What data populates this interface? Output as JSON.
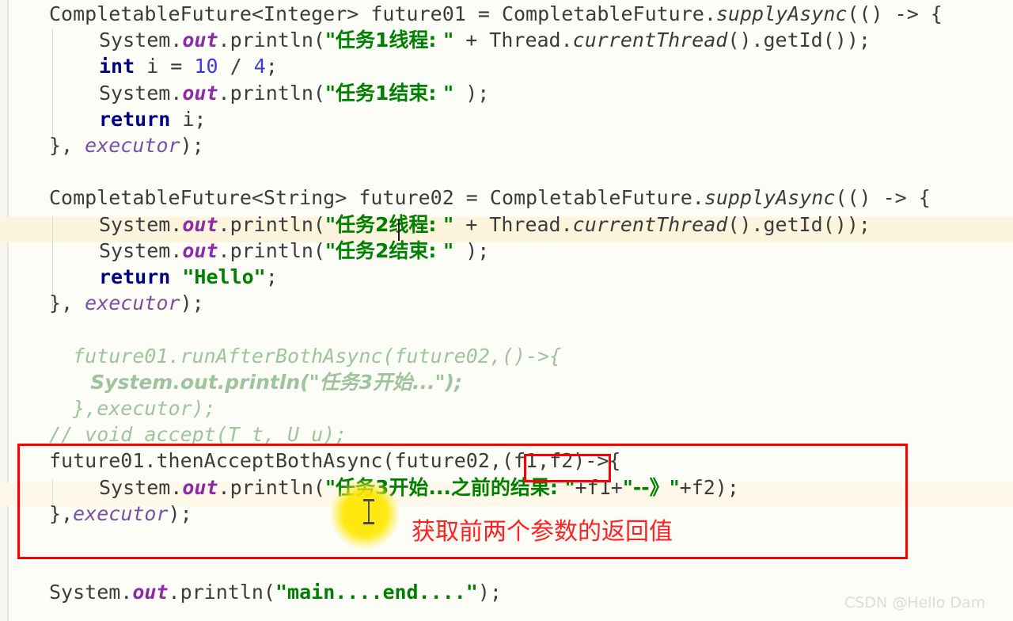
{
  "editor": {
    "language": "java",
    "watermark": "CSDN @Hello Dam",
    "colors": {
      "background": "#fdfdf7",
      "keyword": "#000080",
      "string": "#008000",
      "number": "#3a3ae0",
      "static_field": "#8c2ba8",
      "parameter": "#7a4fa3",
      "commented_code": "#9ec49e",
      "plain_text": "#3c3c3c",
      "annotation_red": "#ff0000",
      "click_highlight_yellow": "#ffe700",
      "current_line_highlight": "#fcf4dc"
    },
    "lines": [
      {
        "indent": 0,
        "tokens": [
          {
            "t": "CompletableFuture<Integer> future01 = CompletableFuture.",
            "c": "cm"
          },
          {
            "t": "supplyAsync",
            "c": "mth"
          },
          {
            "t": "(() -> {",
            "c": "cm"
          }
        ]
      },
      {
        "indent": 1,
        "tokens": [
          {
            "t": "System.",
            "c": "cm"
          },
          {
            "t": "out",
            "c": "fld"
          },
          {
            "t": ".println(",
            "c": "cm"
          },
          {
            "t": "\"任务1线程: \"",
            "c": "str"
          },
          {
            "t": " + Thread.",
            "c": "cm"
          },
          {
            "t": "currentThread",
            "c": "mth"
          },
          {
            "t": "().getId());",
            "c": "cm"
          }
        ]
      },
      {
        "indent": 1,
        "tokens": [
          {
            "t": "int",
            "c": "kw"
          },
          {
            "t": " i = ",
            "c": "cm"
          },
          {
            "t": "10",
            "c": "num"
          },
          {
            "t": " / ",
            "c": "cm"
          },
          {
            "t": "4",
            "c": "num"
          },
          {
            "t": ";",
            "c": "cm"
          }
        ]
      },
      {
        "indent": 1,
        "tokens": [
          {
            "t": "System.",
            "c": "cm"
          },
          {
            "t": "out",
            "c": "fld"
          },
          {
            "t": ".println(",
            "c": "cm"
          },
          {
            "t": "\"任务1结束: \"",
            "c": "str"
          },
          {
            "t": " );",
            "c": "cm"
          }
        ]
      },
      {
        "indent": 1,
        "tokens": [
          {
            "t": "return",
            "c": "kw"
          },
          {
            "t": " i;",
            "c": "cm"
          }
        ]
      },
      {
        "indent": 0,
        "tokens": [
          {
            "t": "}, ",
            "c": "cm"
          },
          {
            "t": "executor",
            "c": "par"
          },
          {
            "t": ");",
            "c": "cm"
          }
        ]
      },
      {
        "indent": 0,
        "tokens": []
      },
      {
        "indent": 0,
        "tokens": [
          {
            "t": "CompletableFuture<String> future02 = CompletableFuture.",
            "c": "cm"
          },
          {
            "t": "supplyAsync",
            "c": "mth"
          },
          {
            "t": "(() -> {",
            "c": "cm"
          }
        ]
      },
      {
        "indent": 1,
        "tokens": [
          {
            "t": "System.",
            "c": "cm"
          },
          {
            "t": "out",
            "c": "fld"
          },
          {
            "t": ".println(",
            "c": "cm"
          },
          {
            "t": "\"任务2线程: \"",
            "c": "str"
          },
          {
            "t": " + Thread.",
            "c": "cm"
          },
          {
            "t": "currentThread",
            "c": "mth"
          },
          {
            "t": "().getId());",
            "c": "cm"
          }
        ]
      },
      {
        "indent": 1,
        "tokens": [
          {
            "t": "System.",
            "c": "cm"
          },
          {
            "t": "out",
            "c": "fld"
          },
          {
            "t": ".println(",
            "c": "cm"
          },
          {
            "t": "\"任务2结束: \"",
            "c": "str"
          },
          {
            "t": " );",
            "c": "cm"
          }
        ]
      },
      {
        "indent": 1,
        "tokens": [
          {
            "t": "return",
            "c": "kw"
          },
          {
            "t": " ",
            "c": "cm"
          },
          {
            "t": "\"Hello\"",
            "c": "str"
          },
          {
            "t": ";",
            "c": "cm"
          }
        ]
      },
      {
        "indent": 0,
        "tokens": [
          {
            "t": "}, ",
            "c": "cm"
          },
          {
            "t": "executor",
            "c": "par"
          },
          {
            "t": ");",
            "c": "cm"
          }
        ]
      },
      {
        "indent": 0,
        "tokens": []
      },
      {
        "indent": 0,
        "tokens": [
          {
            "t": "  future01.runAfterBothAsync(future02,()->{",
            "c": "cmt"
          }
        ]
      },
      {
        "indent": 0,
        "tokens": [
          {
            "t": "      System.out.println(\"任务3开始...\");",
            "c": "cmt"
          }
        ]
      },
      {
        "indent": 0,
        "tokens": [
          {
            "t": "  },executor);",
            "c": "cmt"
          }
        ]
      },
      {
        "indent": 0,
        "tokens": [
          {
            "t": "// void accept(T t, U u);",
            "c": "cmt"
          }
        ]
      },
      {
        "indent": 0,
        "tokens": [
          {
            "t": "future01.thenAcceptBothAsync(future02,(f1,f2)->{",
            "c": "cm"
          }
        ]
      },
      {
        "indent": 1,
        "tokens": [
          {
            "t": "System.",
            "c": "cm"
          },
          {
            "t": "out",
            "c": "fld"
          },
          {
            "t": ".println(",
            "c": "cm"
          },
          {
            "t": "\"任务3开始...之前的结果: \"",
            "c": "str"
          },
          {
            "t": "+f1+",
            "c": "cm"
          },
          {
            "t": "\"--》\"",
            "c": "str"
          },
          {
            "t": "+f2);",
            "c": "cm"
          }
        ]
      },
      {
        "indent": 0,
        "tokens": [
          {
            "t": "},",
            "c": "cm"
          },
          {
            "t": "executor",
            "c": "par"
          },
          {
            "t": ");",
            "c": "cm"
          }
        ]
      },
      {
        "indent": 0,
        "tokens": []
      },
      {
        "indent": 0,
        "tokens": []
      },
      {
        "indent": 0,
        "tokens": [
          {
            "t": "System.",
            "c": "cm"
          },
          {
            "t": "out",
            "c": "fld"
          },
          {
            "t": ".println(",
            "c": "cm"
          },
          {
            "t": "\"main....end....\"",
            "c": "str"
          },
          {
            "t": ");",
            "c": "cm"
          }
        ]
      }
    ]
  },
  "annotations": {
    "note_text": "获取前两个参数的返回值",
    "highlight_target": "(f1,f2)"
  }
}
